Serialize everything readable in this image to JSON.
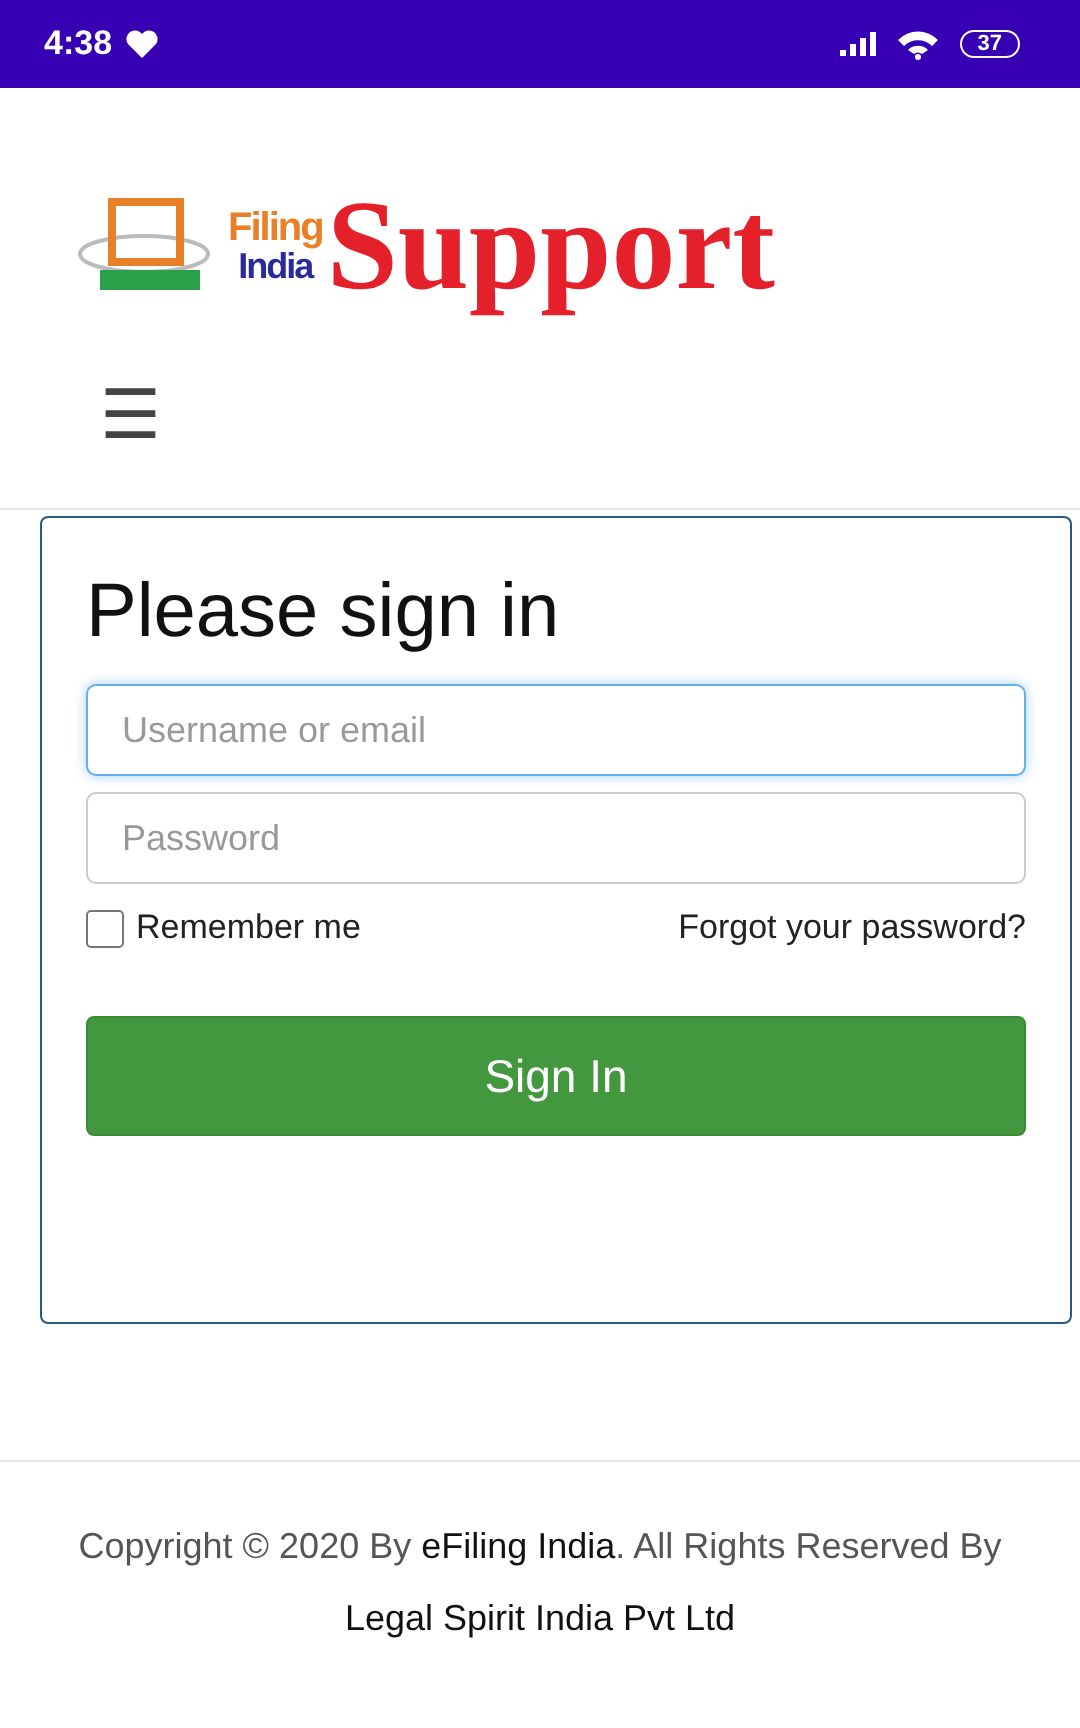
{
  "status_bar": {
    "time": "4:38",
    "battery": "37"
  },
  "logo": {
    "filing": "Filing",
    "india": "India",
    "support": "Support"
  },
  "menu_button": {
    "icon": "☰"
  },
  "form": {
    "title": "Please sign in",
    "fields": [
      {
        "placeholder": "Username or email",
        "focused": true
      },
      {
        "placeholder": "Password",
        "focused": false
      }
    ],
    "remember": {
      "label": "Remember me",
      "checked": false
    },
    "forgot_link": "Forgot your password?",
    "submit": "Sign In"
  },
  "footer": {
    "text_before": "Copyright © 2020 By ",
    "link_1": "eFiling India",
    "text_after": ".  All Rights Reserved By",
    "link_2": "Legal Spirit India Pvt Ltd"
  }
}
